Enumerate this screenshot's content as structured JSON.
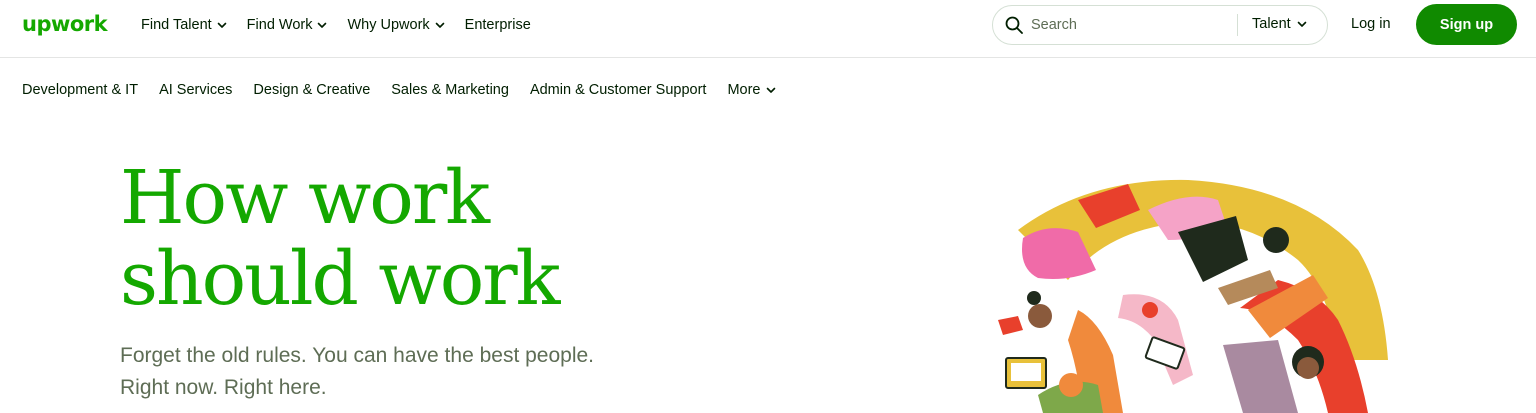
{
  "brand": {
    "logo_text": "upwork",
    "accent": "#14a800",
    "button_green": "#108a00"
  },
  "nav": {
    "items": [
      {
        "label": "Find Talent",
        "dropdown": true
      },
      {
        "label": "Find Work",
        "dropdown": true
      },
      {
        "label": "Why Upwork",
        "dropdown": true
      },
      {
        "label": "Enterprise",
        "dropdown": false
      }
    ]
  },
  "search": {
    "placeholder": "Search",
    "scope": "Talent",
    "icon": "search-icon"
  },
  "auth": {
    "login_label": "Log in",
    "signup_label": "Sign up"
  },
  "categories": {
    "items": [
      "Development & IT",
      "AI Services",
      "Design & Creative",
      "Sales & Marketing",
      "Admin & Customer Support"
    ],
    "more_label": "More"
  },
  "hero": {
    "title_line1": "How work",
    "title_line2": "should work",
    "subtitle_line1": "Forget the old rules. You can have the best people.",
    "subtitle_line2": "Right now. Right here."
  },
  "illustration": {
    "name": "hero-illustration"
  }
}
